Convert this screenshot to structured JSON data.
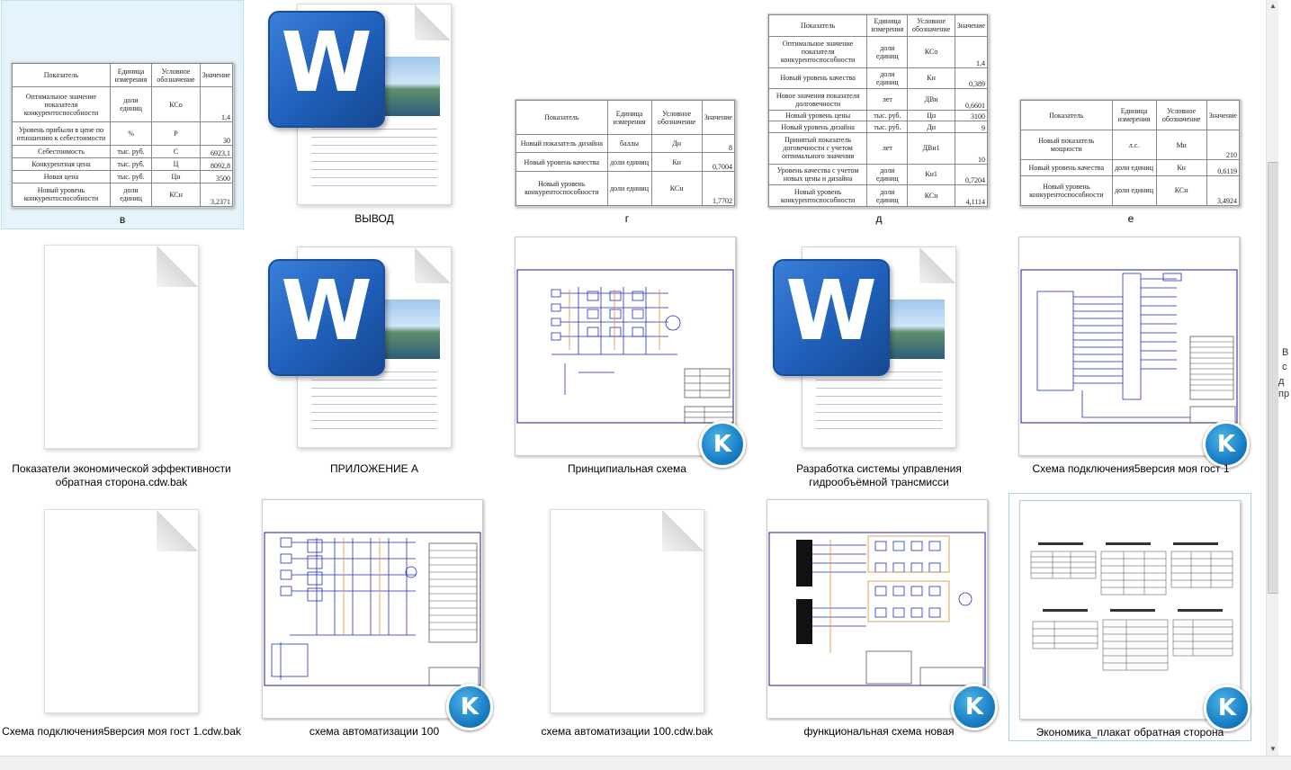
{
  "files": [
    {
      "label": "в",
      "kind": "table"
    },
    {
      "label": "ВЫВОД",
      "kind": "word"
    },
    {
      "label": "г",
      "kind": "table"
    },
    {
      "label": "д",
      "kind": "table"
    },
    {
      "label": "е",
      "kind": "table"
    },
    {
      "label": "Показатели экономической  эффективности обратная сторона.cdw.bak",
      "kind": "blank"
    },
    {
      "label": "ПРИЛОЖЕНИЕ А",
      "kind": "word"
    },
    {
      "label": "Принципиальная схема",
      "kind": "cad"
    },
    {
      "label": "Разработка системы управления гидрообъёмной трансмисси",
      "kind": "word"
    },
    {
      "label": "Схема  подключения5версия моя гост 1",
      "kind": "cad"
    },
    {
      "label": "Схема  подключения5версия моя гост 1.cdw.bak",
      "kind": "blank"
    },
    {
      "label": "схема автоматизации 100",
      "kind": "cad"
    },
    {
      "label": "схема автоматизации 100.cdw.bak",
      "kind": "blank"
    },
    {
      "label": "функциональная схема новая",
      "kind": "cad"
    },
    {
      "label": "Экономика_плакат обратная сторона",
      "kind": "cad"
    }
  ],
  "tables": {
    "headers": [
      "Показатель",
      "Единица измерения",
      "Условное обозначение",
      "Значение"
    ],
    "v": [
      [
        "Оптимальное значение показателя конкурентоспособности",
        "доли единиц",
        "КСо",
        "1,4"
      ],
      [
        "Уровень прибыли в цене по отношению к себестоимости",
        "%",
        "Р",
        "30"
      ],
      [
        "Себестоимость",
        "тыс. руб.",
        "С",
        "6923,1"
      ],
      [
        "Конкурентная цена",
        "тыс. руб.",
        "Ц",
        "8092,8"
      ],
      [
        "Новая цена",
        "тыс. руб.",
        "Цн",
        "3500"
      ],
      [
        "Новый уровень конкурентоспособности",
        "доли единиц",
        "КСн",
        "3,2371"
      ]
    ],
    "g": [
      [
        "Новый показатель дизайна",
        "баллы",
        "Дн",
        "8"
      ],
      [
        "Новый уровень качества",
        "доли единиц",
        "Кн",
        "0,7004"
      ],
      [
        "Новый уровень конкурентоспособности",
        "доли единиц",
        "КСн",
        "1,7702"
      ]
    ],
    "d": [
      [
        "Оптимальное значение показателя конкурентоспособности",
        "доли единиц",
        "КСо",
        "1,4"
      ],
      [
        "Новый уровень качества",
        "доли единиц",
        "Кн",
        "0,389"
      ],
      [
        "Новое значения показателя долговечности",
        "лет",
        "ДВн",
        "0,6601"
      ],
      [
        "Новый уровень цены",
        "тыс. руб.",
        "Цн",
        "3100"
      ],
      [
        "Новый уровень дизайна",
        "тыс. руб.",
        "Дн",
        "9"
      ],
      [
        "Принятый показатель договечности с учетом оптимального значения",
        "лет",
        "ДВн1",
        "10"
      ],
      [
        "Уровень качества с учетом новых цены и дизайна",
        "доли единиц",
        "Кн1",
        "0,7204"
      ],
      [
        "Новый уровень конкурентоспособности",
        "доли единиц",
        "КСн",
        "4,1114"
      ]
    ],
    "e": [
      [
        "Новый показатель мощности",
        "л.с.",
        "Мн",
        "210"
      ],
      [
        "Новый уровень качества",
        "доли единиц",
        "Кн",
        "0,6119"
      ],
      [
        "Новый уровень конкурентоспособности",
        "доли единиц",
        "КСн",
        "3,4924"
      ]
    ]
  },
  "badge_letter": "K",
  "word_letter": "W",
  "side_text": [
    "В",
    "с",
    "д",
    "пр"
  ]
}
